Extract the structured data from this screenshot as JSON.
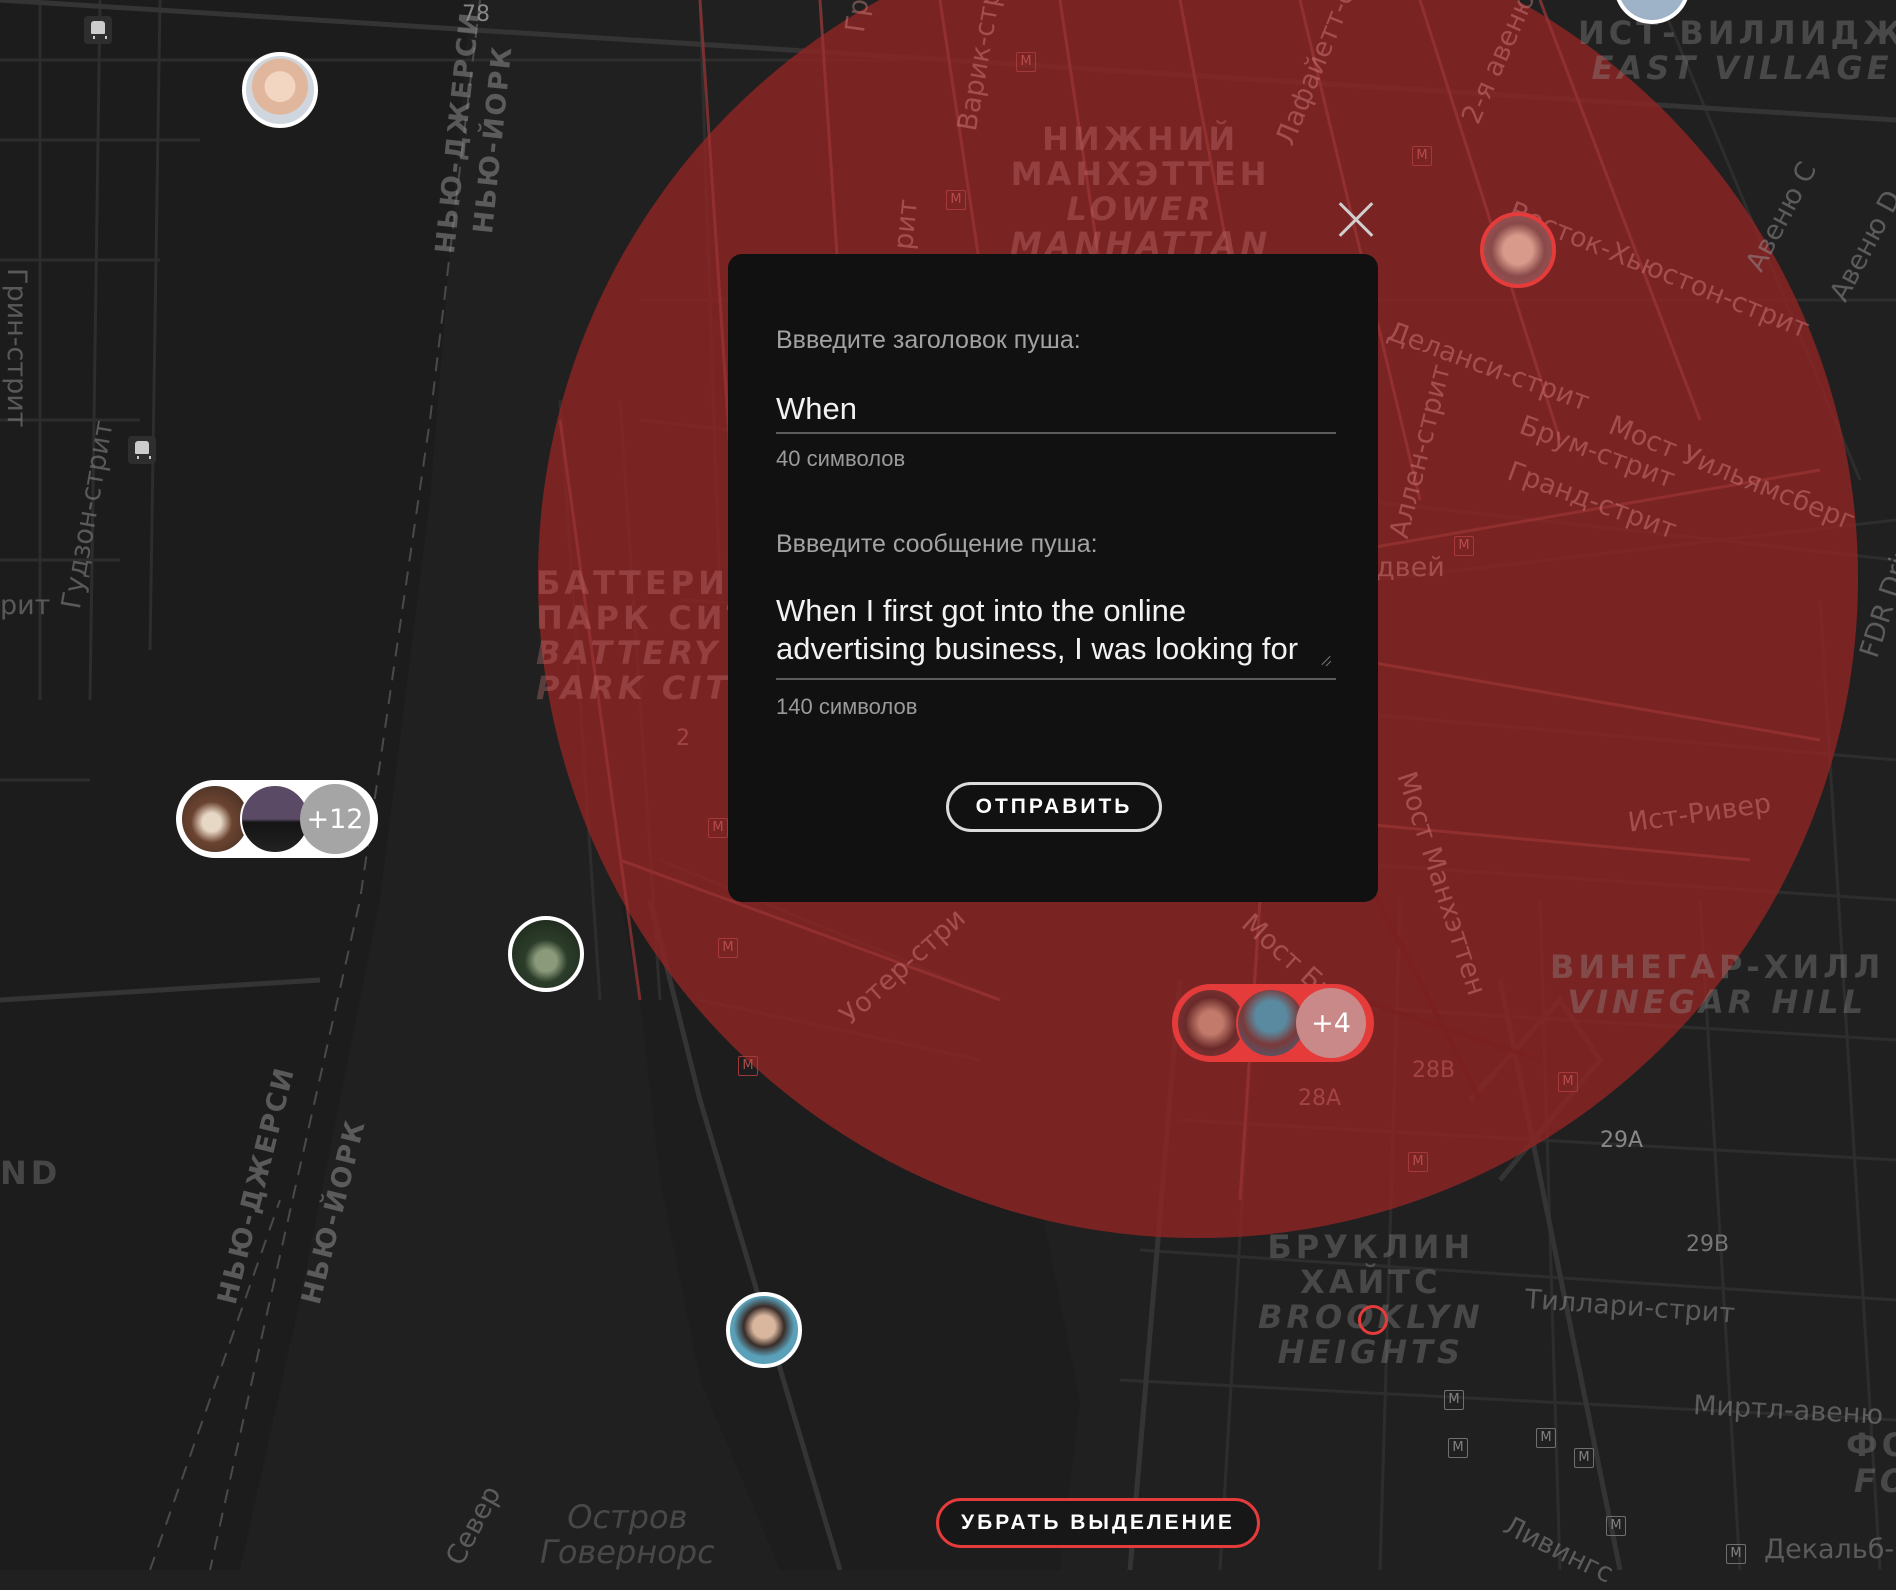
{
  "map": {
    "districts": [
      {
        "id": "lower-manhattan",
        "ru": "НИЖНИЙ\nМАНХЭТТЕН",
        "en": "LOWER\nMANHATTAN"
      },
      {
        "id": "east-village",
        "ru": "ИСТ-ВИЛЛИДЖ",
        "en": "EAST VILLAGE"
      },
      {
        "id": "battery-park",
        "ru": "БАТТЕРИ-\nПАРК СИТИ",
        "en": "BATTERY\nPARK CITY"
      },
      {
        "id": "vinegar-hill",
        "ru": "ВИНЕГАР-ХИЛЛ",
        "en": "VINEGAR HILL"
      },
      {
        "id": "brooklyn-heights",
        "ru": "БРУКЛИН\nХАЙТС",
        "en": "BROOKLYN\nHEIGHTS"
      },
      {
        "id": "governors-island",
        "ru": "",
        "en": "Остров\nГовернорс"
      }
    ],
    "streets": {
      "grinvich": "Гринв",
      "varik": "Варик-стр",
      "lafayette": "Лафайетт-с",
      "second_ave": "2-я авеню",
      "avenue_c": "Авеню C",
      "avenue_d": "Авеню D",
      "east_houston": "Восток-Хьюстон-стрит",
      "delancey": "Деланси-стрит",
      "broome": "Брум-стрит",
      "williamsburg": "Мост Уильямсберг",
      "grand": "Гранд-стрит",
      "allen": "Аллен-стрит",
      "dvey": "двей",
      "fdr": "FDR Drive",
      "east_river": "Ист-Ривер",
      "manhattan_bridge": "Мост Манхэттен",
      "brooklyn_bridge": "Мост Бру",
      "water": "Уотер-стри",
      "trit": "рит",
      "tillary": "Тиллари-стрит",
      "myrtle": "Миртл-авеню",
      "dekalb": "Декальб-",
      "livingston": "Ливингс",
      "green": "Грин-стрит",
      "hudson": "Гудзон-стрит",
      "rit": "рит",
      "nj1": "НЬЮ-ДЖЕРСИ",
      "ny1": "НЬЮ-ЙОРК",
      "nj2": "НЬЮ-ДЖЕРСИ",
      "ny2": "НЬЮ-ЙОРК",
      "nd": "ND",
      "sever": "Север",
      "fo": "ФО",
      "for": "FOR"
    },
    "exits": [
      "78",
      "28B",
      "28A",
      "29A",
      "29B",
      "2"
    ],
    "metro_letter": "M"
  },
  "clusters": {
    "left_count": "+12",
    "right_count": "+4"
  },
  "dialog": {
    "title_label": "Ввведите заголовок пуша:",
    "title_value": "When",
    "title_count": "40 символов",
    "message_label": "Ввведите сообщение пуша:",
    "message_value": "When I first got into the online advertising business, I was looking for",
    "message_count": "140 символов",
    "send_label": "ОТПРАВИТЬ"
  },
  "clear_selection_label": "УБРАТЬ ВЫДЕЛЕНИЕ",
  "colors": {
    "background": "#202020",
    "selection_area": "#8f2424",
    "accent_red": "#e53b3b",
    "dialog_bg": "#111111"
  }
}
